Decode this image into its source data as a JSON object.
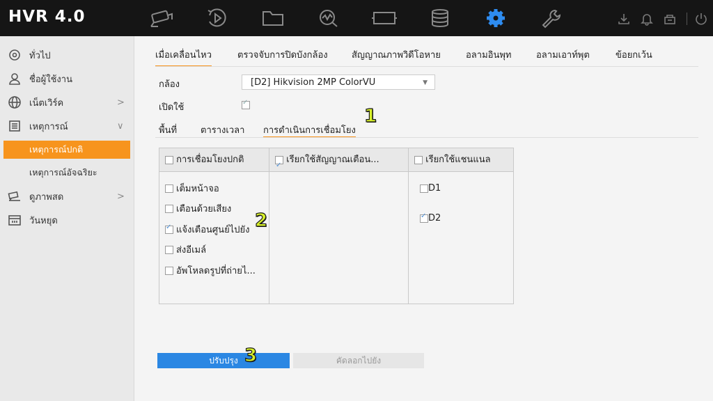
{
  "app": {
    "title": "HVR 4.0"
  },
  "nav": [
    {
      "icon": "camera-icon",
      "active": false
    },
    {
      "icon": "playback-icon",
      "active": false
    },
    {
      "icon": "folder-icon",
      "active": false
    },
    {
      "icon": "search-analytics-icon",
      "active": false
    },
    {
      "icon": "video-channel-icon",
      "active": false
    },
    {
      "icon": "storage-icon",
      "active": false
    },
    {
      "icon": "gear-icon",
      "active": true
    },
    {
      "icon": "wrench-icon",
      "active": false
    }
  ],
  "sidebar": {
    "items": [
      {
        "label": "ทั่วไป",
        "icon": "general-settings-icon"
      },
      {
        "label": "ชื่อผู้ใช้งาน",
        "icon": "user-icon"
      },
      {
        "label": "เน็ตเวิร์ค",
        "icon": "globe-icon",
        "chevron": ">"
      },
      {
        "label": "เหตุการณ์",
        "icon": "event-list-icon",
        "chevron": "∨"
      },
      {
        "label": "ดูภาพสด",
        "icon": "live-view-icon",
        "chevron": ">"
      },
      {
        "label": "วันหยุด",
        "icon": "calendar-icon"
      }
    ],
    "sub": [
      {
        "label": "เหตุการณ์ปกติ",
        "active": true
      },
      {
        "label": "เหตุการณ์อัจฉริยะ",
        "active": false
      }
    ]
  },
  "tabs": [
    "เมื่อเคลื่อนไหว",
    "ตรวจจับการปิดบังกล้อง",
    "สัญญาณภาพวิดีโอหาย",
    "อลามอินพุท",
    "อลามเอาท์พุต",
    "ข้อยกเว้น"
  ],
  "form": {
    "camera_label": "กล้อง",
    "camera_value": "[D2] Hikvision 2MP ColorVU",
    "enable_label": "เปิดใช้"
  },
  "subtabs": [
    "พื้นที่",
    "ตารางเวลา",
    "การดำเนินการเชื่อมโยง"
  ],
  "grid": {
    "col1_header": "การเชื่อมโยงปกติ",
    "col2_header": "เรียกใช้สัญญาณเตือน...",
    "col3_header": "เรียกใช้แชนแนล",
    "col1_items": [
      {
        "label": "เต็มหน้าจอ",
        "checked": false
      },
      {
        "label": "เตือนด้วยเสียง",
        "checked": false
      },
      {
        "label": "แจ้งเตือนศูนย์ไปยัง",
        "checked": true
      },
      {
        "label": "ส่งอีเมล์",
        "checked": false
      },
      {
        "label": "อัพโหลดรูปที่ถ่ายไ...",
        "checked": false
      }
    ],
    "col3_items": [
      {
        "label": "D1",
        "checked": false
      },
      {
        "label": "D2",
        "checked": true
      }
    ]
  },
  "buttons": {
    "apply": "ปรับปรุง",
    "copy": "คัดลอกไปยัง"
  },
  "badges": [
    "1",
    "2",
    "3"
  ]
}
